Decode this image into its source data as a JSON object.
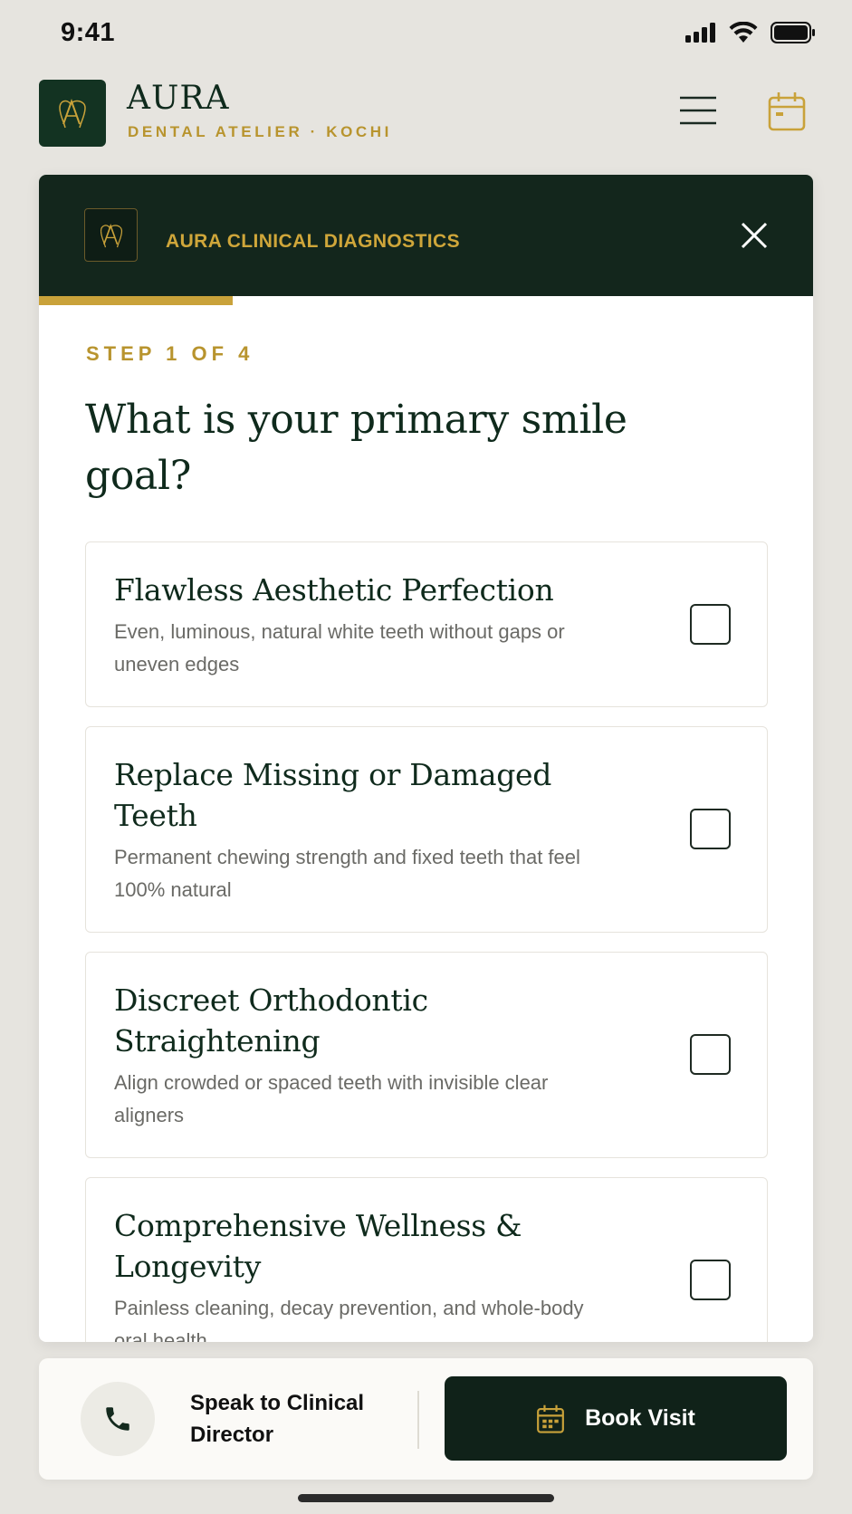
{
  "status_bar": {
    "time": "9:41"
  },
  "header": {
    "brand_name": "AURA",
    "brand_subtitle": "DENTAL ATELIER · KOCHI"
  },
  "modal": {
    "title": "AURA CLINICAL DIAGNOSTICS",
    "progress": {
      "current_step": 1,
      "total_steps": 4,
      "fraction": 0.25
    },
    "step_label": "STEP 1 OF 4",
    "question": "What is your primary smile goal?",
    "options": [
      {
        "title": "Flawless Aesthetic Perfection",
        "description": "Even, luminous, natural white teeth without gaps or uneven edges",
        "checked": false
      },
      {
        "title": "Replace Missing or Damaged Teeth",
        "description": "Permanent chewing strength and fixed teeth that feel 100% natural",
        "checked": false
      },
      {
        "title": "Discreet Orthodontic Straightening",
        "description": "Align crowded or spaced teeth with invisible clear aligners",
        "checked": false
      },
      {
        "title": "Comprehensive Wellness & Longevity",
        "description": "Painless cleaning, decay prevention, and whole-body oral health",
        "checked": false
      }
    ]
  },
  "bottom_bar": {
    "speak_label": "Speak to Clinical Director",
    "book_label": "Book Visit"
  },
  "icons": {
    "status": [
      "cellular-signal-icon",
      "wifi-icon",
      "battery-icon"
    ],
    "header": [
      "brand-logo-icon",
      "menu-icon",
      "calendar-icon"
    ],
    "modal": [
      "modal-logo-icon",
      "close-icon"
    ],
    "bottom": [
      "phone-icon",
      "calendar-icon"
    ]
  },
  "colors": {
    "brand_green": "#13261c",
    "accent_gold": "#c9a23a",
    "background": "#e6e4df"
  }
}
